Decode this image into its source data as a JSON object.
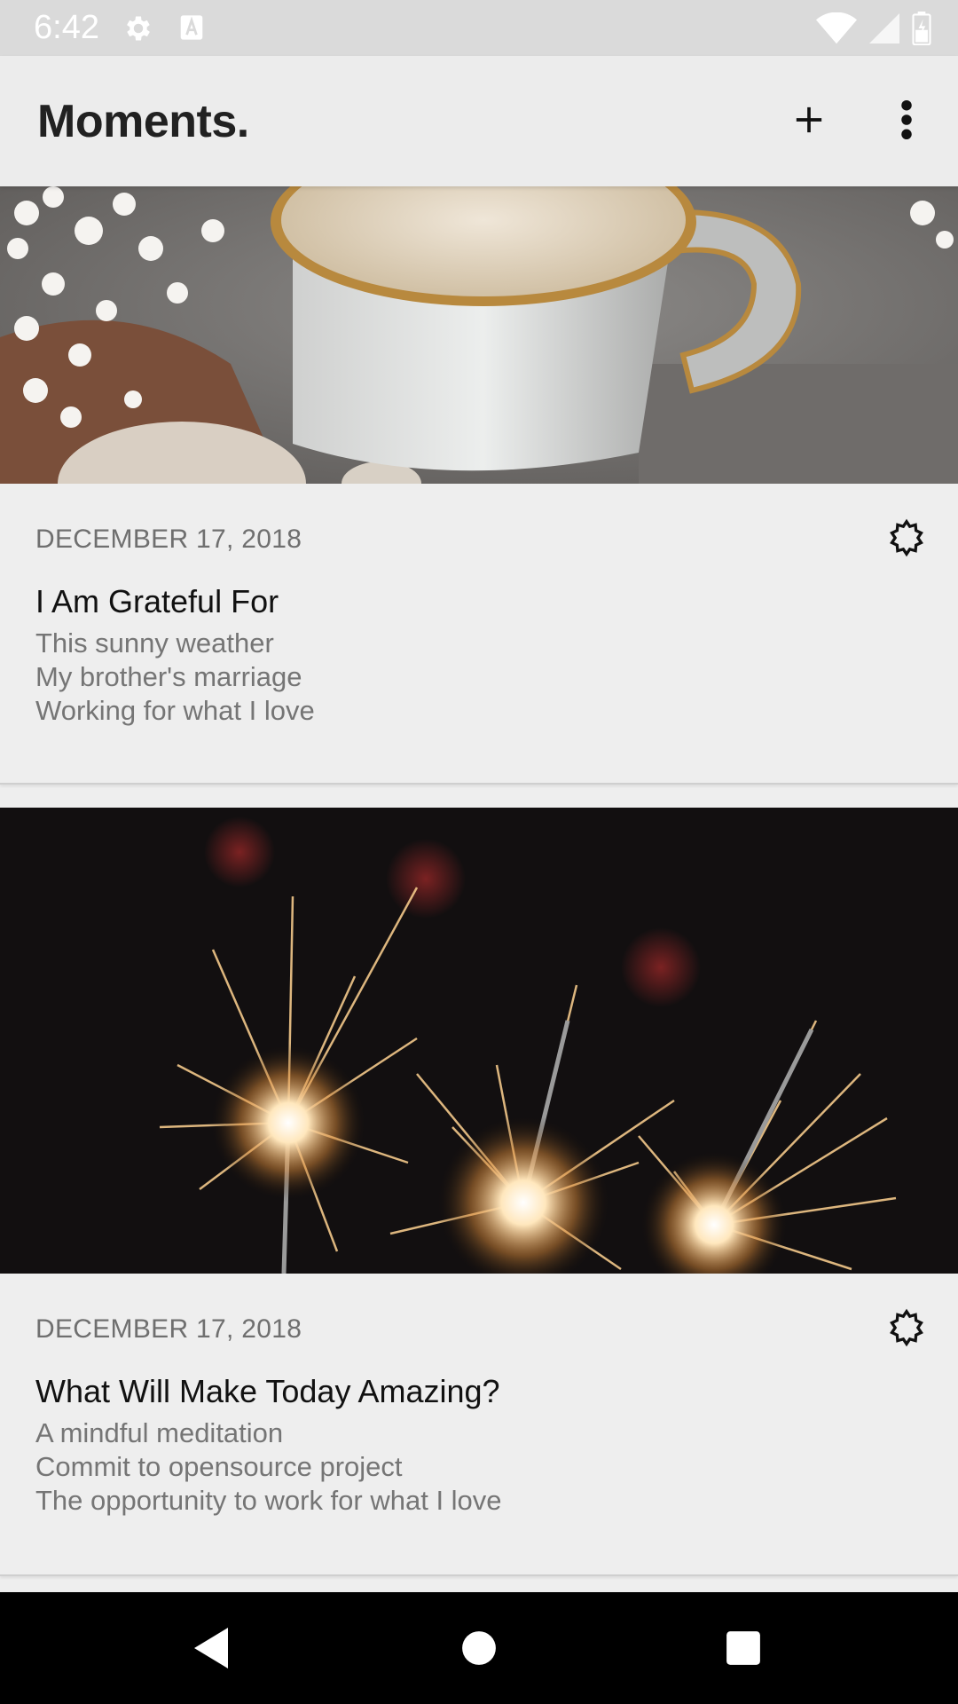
{
  "status_bar": {
    "time": "6:42",
    "icons": [
      "settings-icon",
      "text-a-icon",
      "wifi-icon",
      "signal-icon",
      "battery-icon"
    ]
  },
  "app_bar": {
    "title": "Moments.",
    "actions": [
      "add-icon",
      "more-vert-icon"
    ]
  },
  "cards": [
    {
      "date": "DECEMBER 17, 2018",
      "title": "I Am Grateful For",
      "lines": [
        "This sunny weather",
        "My brother's marriage",
        "Working for what I love"
      ],
      "image": "coffee-cup-photo",
      "action_icon": "settings-icon"
    },
    {
      "date": "DECEMBER 17, 2018",
      "title": "What Will Make Today Amazing?",
      "lines": [
        "A mindful meditation",
        "Commit to opensource project",
        "The opportunity to work for what I love"
      ],
      "image": "sparklers-photo",
      "action_icon": "settings-icon"
    }
  ],
  "nav_bar": {
    "buttons": [
      "back-icon",
      "home-icon",
      "recents-icon"
    ]
  },
  "colors": {
    "background": "#eeeeee",
    "status_bar": "#dadada",
    "nav_bar": "#000000",
    "title_text": "#212121",
    "secondary_text": "#757575"
  }
}
